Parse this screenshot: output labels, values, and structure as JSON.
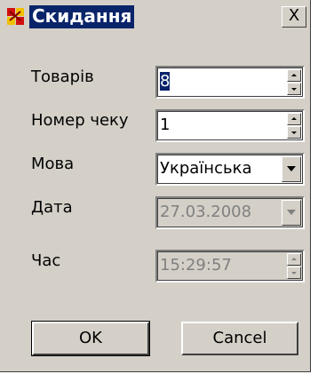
{
  "window": {
    "title": "Скидання",
    "title_icon": "discount-app-icon",
    "close_label": "X"
  },
  "form": {
    "goods": {
      "label": "Товарів",
      "value": "8"
    },
    "receipt": {
      "label": "Номер чеку",
      "value": "1"
    },
    "language": {
      "label": "Мова",
      "value": "Українська"
    },
    "date": {
      "label": "Дата",
      "value": "27.03.2008"
    },
    "time": {
      "label": "Час",
      "value": "15:29:57"
    }
  },
  "buttons": {
    "ok": "OK",
    "cancel": "Cancel"
  },
  "colors": {
    "face": "#d4d0c8",
    "title_highlight": "#0a246a",
    "disabled_text": "#808080"
  }
}
